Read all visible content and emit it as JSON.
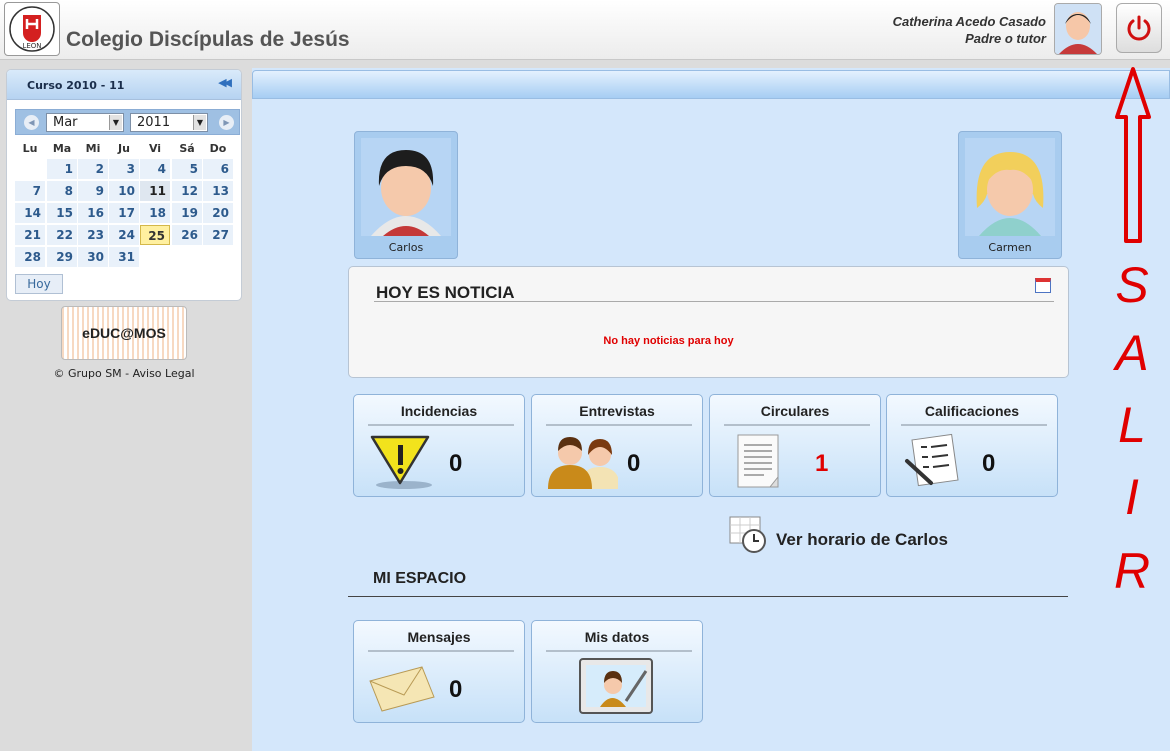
{
  "header": {
    "school_name": "Colegio Discípulas de Jesús",
    "logo_text": "LEON",
    "user_name": "Catherina Acedo Casado",
    "user_role": "Padre o tutor",
    "logout_icon": "power-icon",
    "accent": "#e00000"
  },
  "sidebar": {
    "course": "Curso 2010 - 11",
    "calendar": {
      "month": "Mar",
      "year": "2011",
      "weekdays": [
        "Lu",
        "Ma",
        "Mi",
        "Ju",
        "Vi",
        "Sá",
        "Do"
      ],
      "days": [
        "1",
        "2",
        "3",
        "4",
        "5",
        "6",
        "7",
        "8",
        "9",
        "10",
        "11",
        "12",
        "13",
        "14",
        "15",
        "16",
        "17",
        "18",
        "19",
        "20",
        "21",
        "22",
        "23",
        "24",
        "25",
        "26",
        "27",
        "28",
        "29",
        "30",
        "31"
      ],
      "today": "25",
      "current": "11",
      "today_button": "Hoy"
    },
    "educamos": "eDUC@MOS",
    "legal": "Grupo SM - Aviso Legal",
    "copyright_symbol": "©"
  },
  "main": {
    "children": [
      "Carlos",
      "Carmen"
    ],
    "news": {
      "title": "HOY ES NOTICIA",
      "empty": "No hay noticias para hoy"
    },
    "tiles": [
      {
        "label": "Incidencias",
        "value": "0",
        "icon": "warning-icon"
      },
      {
        "label": "Entrevistas",
        "value": "0",
        "icon": "people-icon"
      },
      {
        "label": "Circulares",
        "value": "1",
        "icon": "document-icon"
      },
      {
        "label": "Calificaciones",
        "value": "0",
        "icon": "grades-icon"
      }
    ],
    "schedule_link": "Ver horario de Carlos",
    "my_space_title": "MI ESPACIO",
    "my_space": [
      {
        "label": "Mensajes",
        "value": "0",
        "icon": "envelope-icon"
      },
      {
        "label": "Mis datos",
        "icon": "profile-edit-icon"
      }
    ]
  },
  "annotation": {
    "letters": [
      "S",
      "A",
      "L",
      "I",
      "R"
    ],
    "color": "#e00000"
  }
}
